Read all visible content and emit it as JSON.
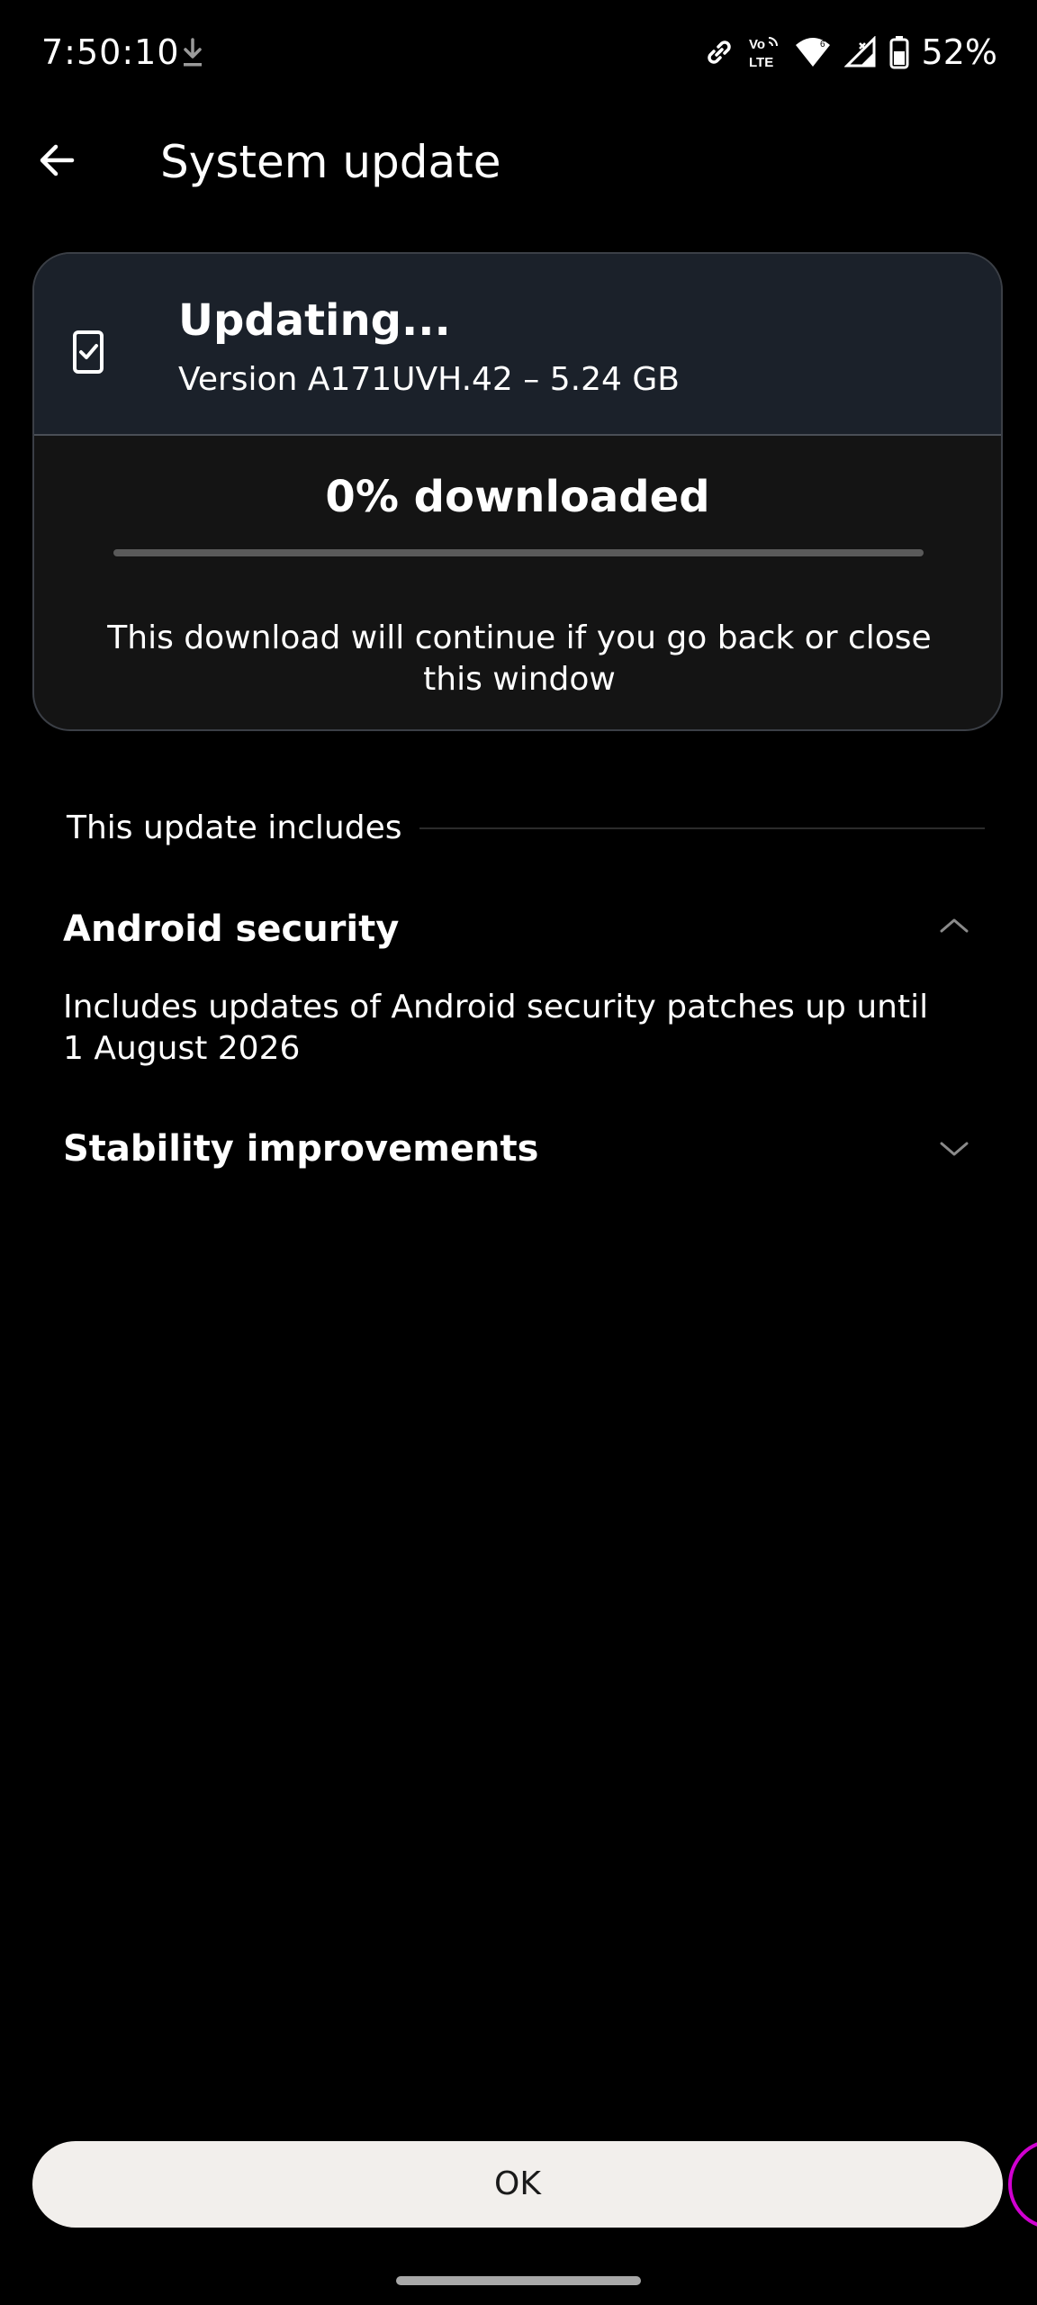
{
  "status_bar": {
    "time": "7:50:10",
    "battery": "52%"
  },
  "header": {
    "title": "System update"
  },
  "update_card": {
    "title": "Updating...",
    "version": "Version A171UVH.42 – 5.24 GB",
    "progress_label": "0% downloaded",
    "progress_percent": 0,
    "note": "This download will continue if you go back or close this window"
  },
  "includes": {
    "label": "This update includes",
    "items": [
      {
        "title": "Android security",
        "expanded": true,
        "body": "Includes updates of Android security patches up until 1 August 2026"
      },
      {
        "title": "Stability improvements",
        "expanded": false
      }
    ]
  },
  "footer": {
    "ok_label": "OK"
  },
  "icons": {
    "back": "arrow-left-icon",
    "download": "download-icon",
    "link": "link-icon",
    "volte": "volte-icon",
    "wifi": "wifi-icon",
    "signal": "signal-icon",
    "battery": "battery-icon",
    "update_check": "phone-check-icon",
    "expanded": "chevron-up-icon",
    "collapsed": "chevron-down-icon"
  },
  "colors": {
    "background": "#000000",
    "card_top": "#1b212a",
    "card_body": "#141414",
    "button": "#f2efec",
    "edge_handle": "#d100d1"
  }
}
